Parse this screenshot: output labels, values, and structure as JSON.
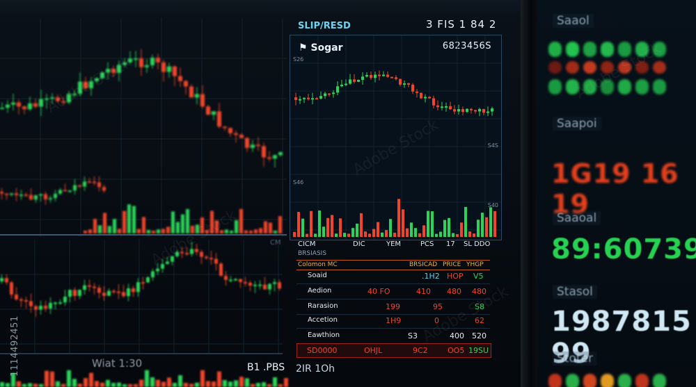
{
  "top_bar": {
    "left_text": "",
    "center_text": ""
  },
  "left_panel": {
    "title": "",
    "subtitle": "",
    "x_labels": [
      "CM"
    ]
  },
  "main_panel": {
    "header": "SLIP/RESD",
    "top_right": "3 FIS 1 84 2",
    "brand": "Sogar",
    "value": "6823456S",
    "y_ticks": [
      "S26",
      "S46",
      "S4S",
      "S40"
    ],
    "x_labels": [
      "CICM",
      "DIC",
      "YEM",
      "PCS",
      "17",
      "SL DDO"
    ]
  },
  "order_book": {
    "title": "BRSIASIS",
    "headers": [
      "Colomon MC",
      "BRSICAD",
      "PRICE",
      "YHGP"
    ],
    "rows": [
      {
        "label": "Soaid",
        "c1": "",
        "c2": ".1H2",
        "c3": "HOP",
        "c4": "V5"
      },
      {
        "label": "Aedion",
        "c1": "40 FO",
        "c2": "410",
        "c3": "480",
        "c4": "480"
      },
      {
        "label": "Rarasion",
        "c1": "",
        "c2": "199",
        "c3": "95",
        "c4": "S8"
      },
      {
        "label": "Accetion",
        "c1": "",
        "c2": "1H9",
        "c3": "0",
        "c4": "62"
      },
      {
        "label": "Eawthion",
        "c1": "",
        "c2": "S3",
        "c3": "400",
        "c4": "520"
      }
    ],
    "last_row": {
      "label": "SD0000",
      "c1": "OHJL",
      "c2": "9C2",
      "c3": "OO5",
      "c4": "19SU"
    }
  },
  "bottom": {
    "left_label": "Wiat 1:30",
    "mid_label": "B1 .PBS",
    "mid2_label": "2IR 1Oh"
  },
  "side_stamp": "1114492451",
  "right_panel": {
    "labels": [
      "Saaol",
      "Saapoi",
      "Saaoal",
      "Stasol",
      "Stoter"
    ],
    "big_red": "1G19 16 19",
    "big_green": "89:60739",
    "big_white": "1987815 99"
  },
  "watermark": "Adobe Stock",
  "colors": {
    "up": "#2bd45a",
    "down": "#f0442a",
    "accent": "#6fd3f0",
    "border": "#2b4a63",
    "header": "#f0b23a"
  }
}
